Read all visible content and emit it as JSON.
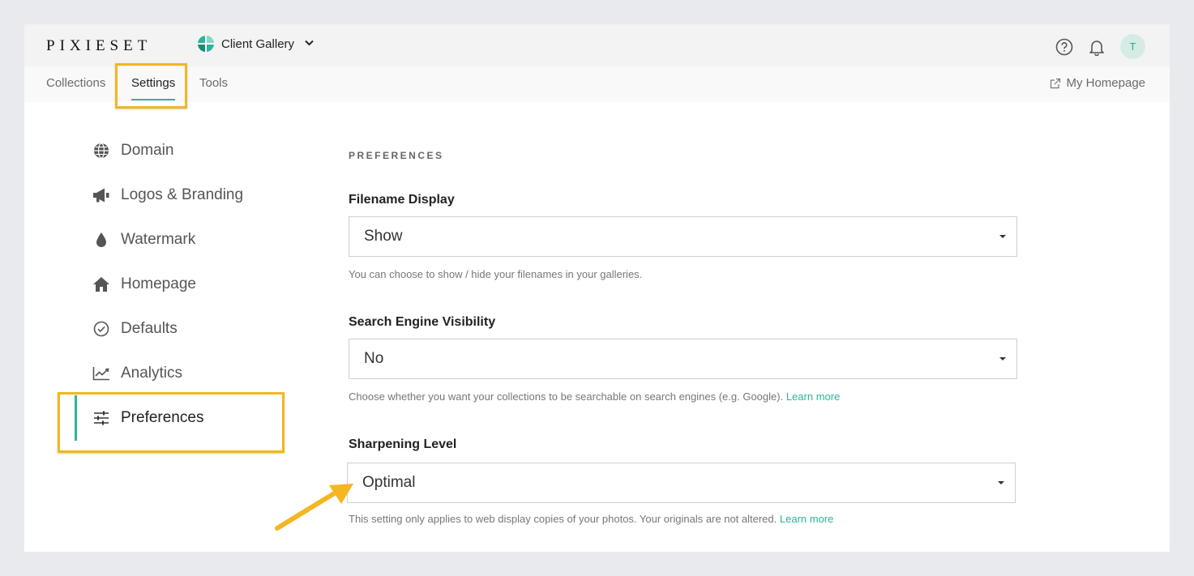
{
  "app": {
    "logo_text": "PIXIESET",
    "product_name": "Client Gallery"
  },
  "header": {
    "icons": [
      "help-circle-icon",
      "bell-icon"
    ],
    "avatar_initial": "T",
    "accent_color": "#2fb39a"
  },
  "subnav": {
    "tabs": [
      {
        "label": "Collections",
        "active": false
      },
      {
        "label": "Settings",
        "active": true
      },
      {
        "label": "Tools",
        "active": false
      }
    ],
    "homepage_link": "My Homepage"
  },
  "sidebar": {
    "items": [
      {
        "label": "Domain",
        "icon": "globe-icon"
      },
      {
        "label": "Logos & Branding",
        "icon": "megaphone-icon"
      },
      {
        "label": "Watermark",
        "icon": "droplet-icon"
      },
      {
        "label": "Homepage",
        "icon": "home-icon"
      },
      {
        "label": "Defaults",
        "icon": "check-circle-icon"
      },
      {
        "label": "Analytics",
        "icon": "line-chart-icon"
      },
      {
        "label": "Preferences",
        "icon": "sliders-icon",
        "active": true
      }
    ]
  },
  "main": {
    "section_title": "PREFERENCES",
    "fields": [
      {
        "label": "Filename Display",
        "value": "Show",
        "help": "You can choose to show / hide your filenames in your galleries."
      },
      {
        "label": "Search Engine Visibility",
        "value": "No",
        "help": "Choose whether you want your collections to be searchable on search engines (e.g. Google).",
        "link": "Learn more"
      },
      {
        "label": "Sharpening Level",
        "value": "Optimal",
        "help": "This setting only applies to web display copies of your photos. Your originals are not altered.",
        "link": "Learn more"
      }
    ]
  },
  "annotations": {
    "highlight_color": "#f4b621"
  }
}
